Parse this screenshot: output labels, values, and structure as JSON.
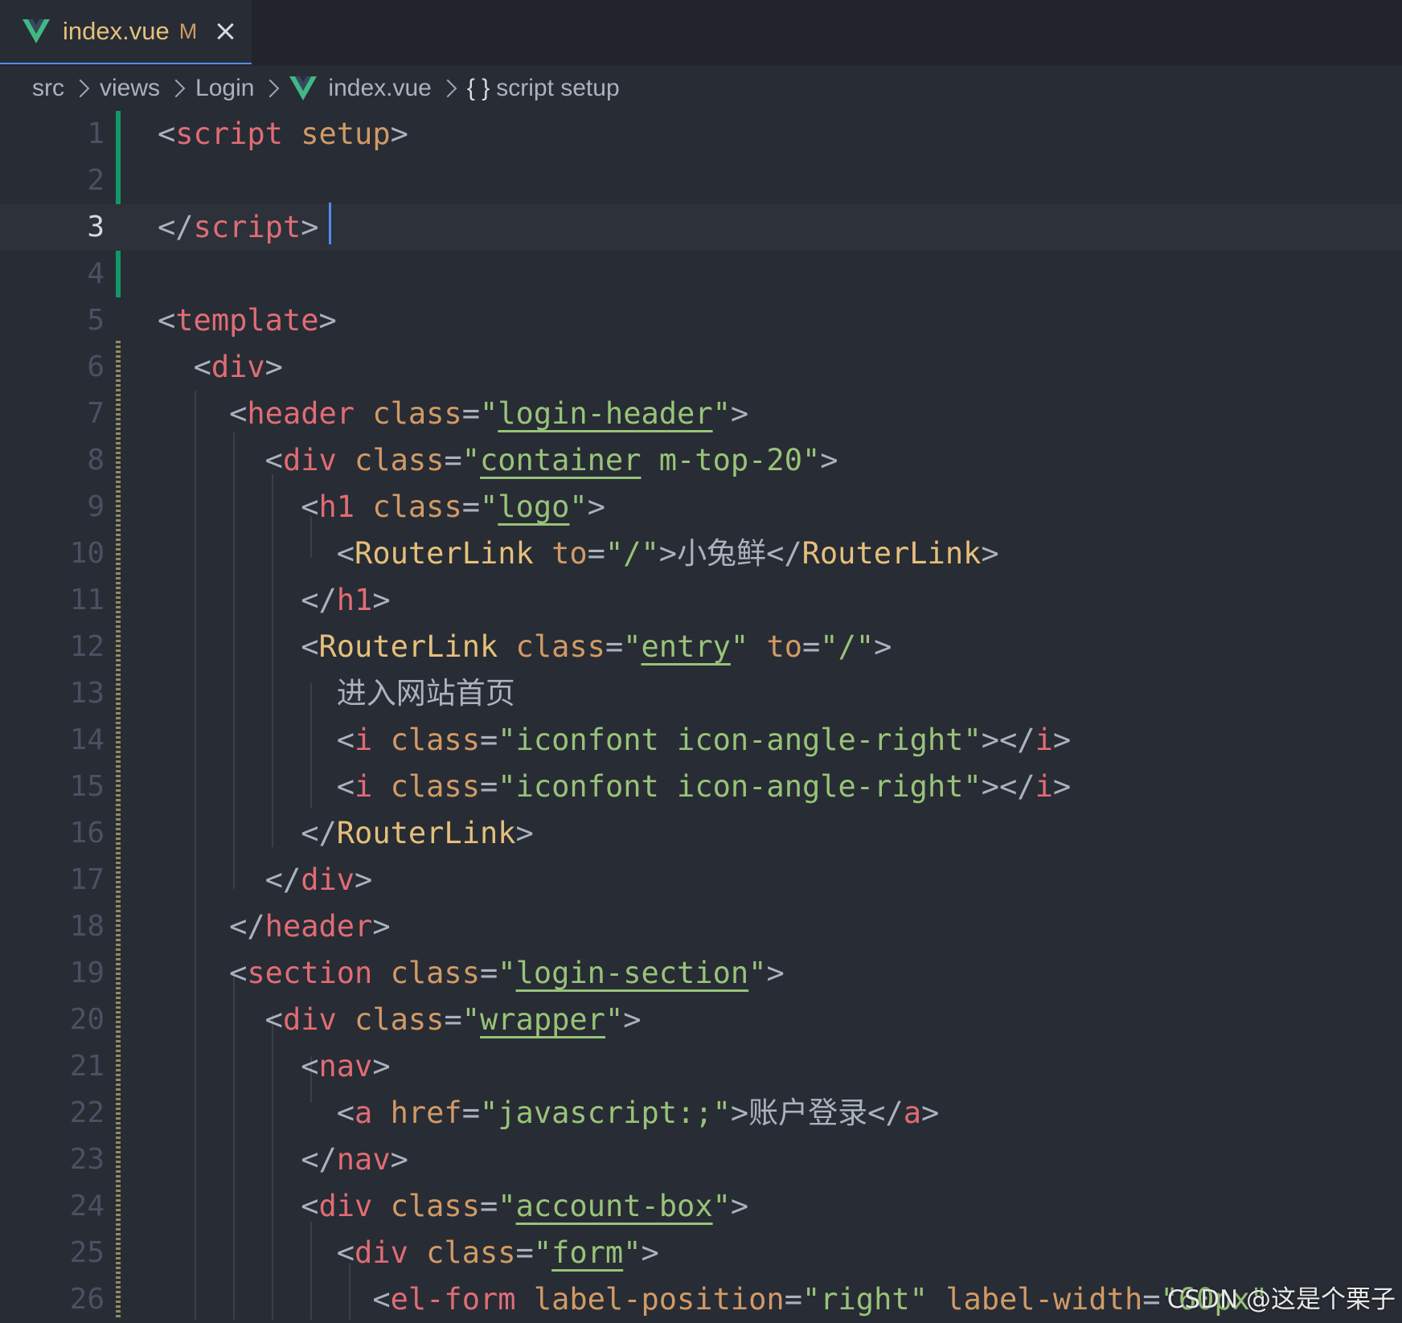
{
  "tab": {
    "title": "index.vue",
    "status": "M",
    "icon": "vue-icon",
    "close_icon": "close-icon"
  },
  "breadcrumb": {
    "items": [
      "src",
      "views",
      "Login",
      "index.vue",
      "script setup"
    ],
    "braces": "{ }"
  },
  "editor": {
    "current_line": 3,
    "lines": [
      {
        "n": "1"
      },
      {
        "n": "2"
      },
      {
        "n": "3"
      },
      {
        "n": "4"
      },
      {
        "n": "5"
      },
      {
        "n": "6"
      },
      {
        "n": "7"
      },
      {
        "n": "8"
      },
      {
        "n": "9"
      },
      {
        "n": "10"
      },
      {
        "n": "11"
      },
      {
        "n": "12"
      },
      {
        "n": "13"
      },
      {
        "n": "14"
      },
      {
        "n": "15"
      },
      {
        "n": "16"
      },
      {
        "n": "17"
      },
      {
        "n": "18"
      },
      {
        "n": "19"
      },
      {
        "n": "20"
      },
      {
        "n": "21"
      },
      {
        "n": "22"
      },
      {
        "n": "23"
      },
      {
        "n": "24"
      },
      {
        "n": "25"
      },
      {
        "n": "26"
      }
    ],
    "code": {
      "l1_tag": "script",
      "l1_attr": "setup",
      "l3_tag": "script",
      "l5_tag": "template",
      "l6_tag": "div",
      "l7_tag": "header",
      "l7_attr": "class",
      "l7_val": "login-header",
      "l8_tag": "div",
      "l8_attr": "class",
      "l8_val1": "container",
      "l8_val2": " m-top-20",
      "l9_tag": "h1",
      "l9_attr": "class",
      "l9_val": "logo",
      "l10_tag": "RouterLink",
      "l10_attr": "to",
      "l10_val": "/",
      "l10_text": "小兔鲜",
      "l11_tag": "h1",
      "l12_tag": "RouterLink",
      "l12_attr1": "class",
      "l12_val1": "entry",
      "l12_attr2": "to",
      "l12_val2": "/",
      "l13_text": "进入网站首页",
      "l14_tag": "i",
      "l14_attr": "class",
      "l14_val": "iconfont icon-angle-right",
      "l15_tag": "i",
      "l15_attr": "class",
      "l15_val": "iconfont icon-angle-right",
      "l16_tag": "RouterLink",
      "l17_tag": "div",
      "l18_tag": "header",
      "l19_tag": "section",
      "l19_attr": "class",
      "l19_val": "login-section",
      "l20_tag": "div",
      "l20_attr": "class",
      "l20_val": "wrapper",
      "l21_tag": "nav",
      "l22_tag": "a",
      "l22_attr": "href",
      "l22_val": "javascript:;",
      "l22_text": "账户登录",
      "l23_tag": "nav",
      "l24_tag": "div",
      "l24_attr": "class",
      "l24_val": "account-box",
      "l25_tag": "div",
      "l25_attr": "class",
      "l25_val": "form",
      "l26_tag": "el-form",
      "l26_attr1": "label-position",
      "l26_val1": "right",
      "l26_attr2": "label-width",
      "l26_val2": "60px"
    }
  },
  "watermark": "CSDN @这是个栗子",
  "colors": {
    "background": "#282c34",
    "tag": "#e06c75",
    "component": "#e5c07b",
    "attribute": "#d19a66",
    "string": "#98c379",
    "git_added": "#109868",
    "cursor": "#528bff"
  }
}
